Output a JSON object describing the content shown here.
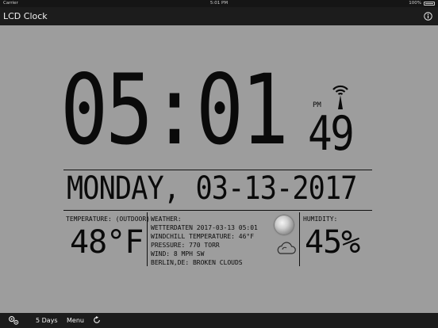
{
  "status_bar": {
    "carrier": "Carrier",
    "time": "5:01 PM",
    "battery": "100%"
  },
  "nav": {
    "title": "LCD Clock",
    "info_icon": "info-icon"
  },
  "clock": {
    "time": "05:01",
    "ampm": "PM",
    "seconds": "49",
    "signal_icon": "radio-signal-icon"
  },
  "date": "MONDAY, 03-13-2017",
  "temperature": {
    "label": "TEMPERATURE: (OUTDOOR)",
    "value": "48°F"
  },
  "weather": {
    "label": "WEATHER:",
    "lines": [
      "WETTERDATEN 2017-03-13 05:01",
      "WINDCHILL TEMPERATURE: 46°F",
      "PRESSURE: 770 TORR",
      "WIND: 8 MPH SW",
      "BERLIN,DE: BROKEN CLOUDS"
    ],
    "moon_icon": "moon-icon",
    "cloud_icon": "cloud-icon"
  },
  "humidity": {
    "label": "HUMIDITY:",
    "value": "45%"
  },
  "toolbar": {
    "settings_icon": "settings-icon",
    "five_days": "5 Days",
    "menu": "Menu",
    "refresh_icon": "refresh-icon"
  }
}
